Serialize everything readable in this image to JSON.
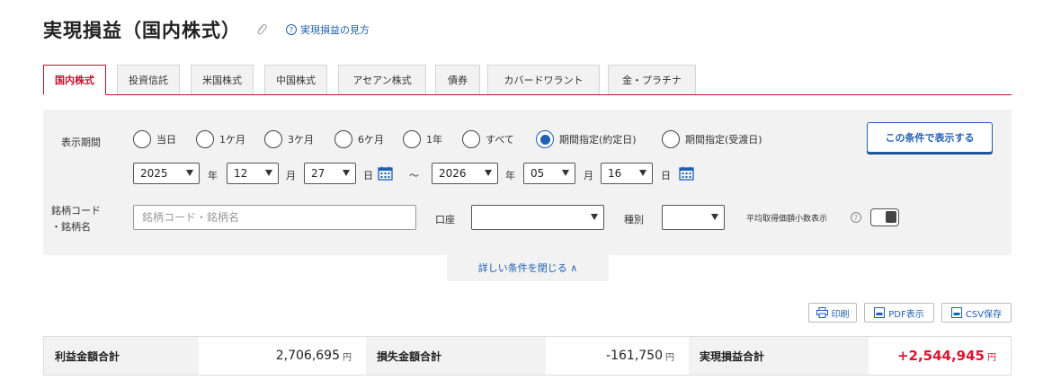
{
  "header": {
    "title": "実現損益（国内株式）",
    "help_link": "実現損益の見方"
  },
  "tabs": [
    {
      "label": "国内株式",
      "active": true
    },
    {
      "label": "投資信託"
    },
    {
      "label": "米国株式"
    },
    {
      "label": "中国株式"
    },
    {
      "label": "アセアン株式"
    },
    {
      "label": "債券"
    },
    {
      "label": "カバードワラント"
    },
    {
      "label": "金・プラチナ"
    }
  ],
  "filters": {
    "period_label": "表示期間",
    "period_options": [
      "当日",
      "1ケ月",
      "3ケ月",
      "6ケ月",
      "1年",
      "すべて",
      "期間指定(約定日)",
      "期間指定(受渡日)"
    ],
    "period_selected": "期間指定(約定日)",
    "submit_label": "この条件で表示する",
    "from": {
      "year": "2025",
      "month": "12",
      "day": "27"
    },
    "to": {
      "year": "2026",
      "month": "05",
      "day": "16"
    },
    "unit_year": "年",
    "unit_month": "月",
    "unit_day": "日",
    "range_sep": "～",
    "code_label_1": "銘柄コード",
    "code_label_2": "・銘柄名",
    "code_placeholder": "銘柄コード・銘柄名",
    "account_label": "口座",
    "account_value": "",
    "type_label": "種別",
    "type_value": "",
    "decimal_label": "平均取得価額小数表示",
    "decimal_help": "?",
    "collapse_label": "詳しい条件を閉じる ∧"
  },
  "toolbar": {
    "print": "印刷",
    "pdf": "PDF表示",
    "csv": "CSV保存"
  },
  "summary": {
    "profit_label": "利益金額合計",
    "profit_value": "2,706,695",
    "loss_label": "損失金額合計",
    "loss_value": "-161,750",
    "total_label": "実現損益合計",
    "total_value": "+2,544,945",
    "yen": "円"
  },
  "colors": {
    "accent_red": "#c8102e",
    "link_blue": "#1f5fb4",
    "profit_red": "#e0132f"
  }
}
